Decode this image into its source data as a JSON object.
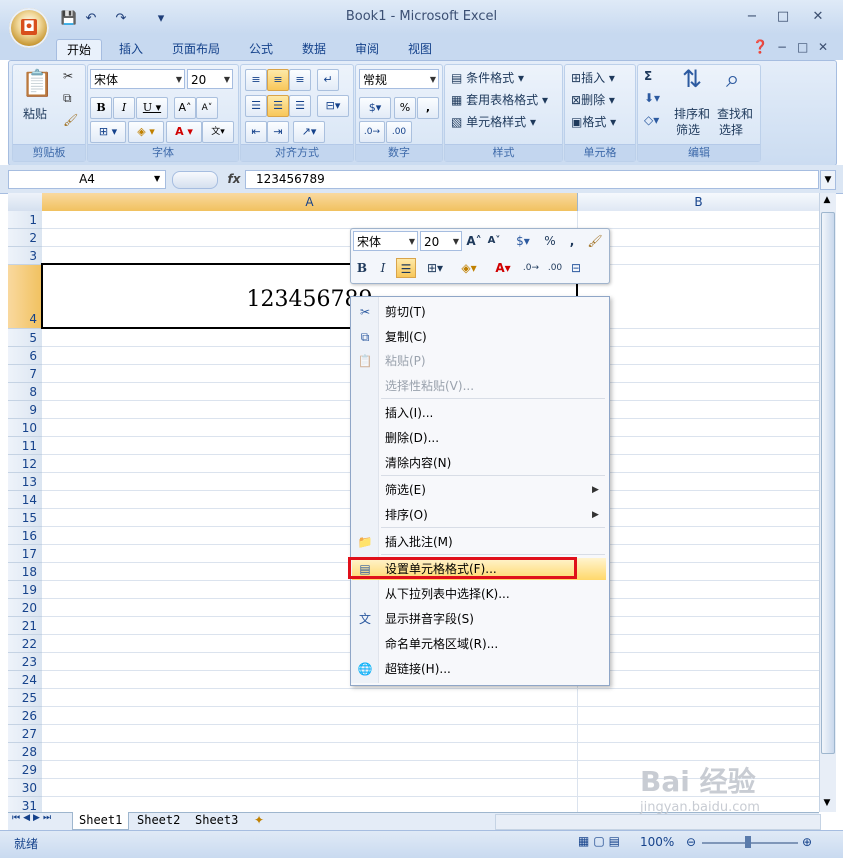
{
  "window": {
    "title": "Book1 - Microsoft Excel",
    "minimize": "−",
    "maximize": "□",
    "close": "✕"
  },
  "qat": {
    "save": "💾",
    "undo": "↶",
    "redo": "↷",
    "more": "▾"
  },
  "tabs": [
    "开始",
    "插入",
    "页面布局",
    "公式",
    "数据",
    "审阅",
    "视图"
  ],
  "ribbon": {
    "clipboard": {
      "label": "剪贴板",
      "paste": "粘贴"
    },
    "font": {
      "label": "字体",
      "name": "宋体",
      "size": "20"
    },
    "alignment": {
      "label": "对齐方式"
    },
    "number": {
      "label": "数字",
      "format": "常规",
      "percent": "%",
      "comma": ","
    },
    "styles": {
      "label": "样式",
      "conditional": "条件格式",
      "table": "套用表格格式",
      "cell": "单元格样式"
    },
    "cells": {
      "label": "单元格",
      "insert": "插入",
      "delete": "删除",
      "format": "格式"
    },
    "editing": {
      "label": "编辑",
      "sum": "Σ",
      "sort": "排序和\n筛选",
      "sort1": "排序和",
      "sort2": "筛选",
      "find1": "查找和",
      "find2": "选择"
    }
  },
  "formula_bar": {
    "name_box": "A4",
    "fx": "fx",
    "value": "123456789"
  },
  "columns": [
    "A",
    "B"
  ],
  "rows": [
    "1",
    "2",
    "3",
    "4",
    "5",
    "6",
    "7",
    "8",
    "9",
    "10",
    "11",
    "12",
    "13",
    "14",
    "15",
    "16",
    "17",
    "18",
    "19",
    "20",
    "21",
    "22",
    "23",
    "24",
    "25",
    "26",
    "27",
    "28",
    "29",
    "30",
    "31"
  ],
  "cell_a4": "123456789",
  "mini_toolbar": {
    "font": "宋体",
    "size": "20",
    "percent": "%",
    "comma": ","
  },
  "context_menu": [
    {
      "label": "剪切(T)",
      "icon": "scissors-icon",
      "disabled": false
    },
    {
      "label": "复制(C)",
      "icon": "copy-icon",
      "disabled": false
    },
    {
      "label": "粘贴(P)",
      "icon": "paste-icon",
      "disabled": true
    },
    {
      "label": "选择性粘贴(V)...",
      "icon": "",
      "disabled": true
    },
    {
      "label": "插入(I)...",
      "icon": "",
      "disabled": false
    },
    {
      "label": "删除(D)...",
      "icon": "",
      "disabled": false
    },
    {
      "label": "清除内容(N)",
      "icon": "",
      "disabled": false
    },
    {
      "label": "筛选(E)",
      "icon": "",
      "disabled": false,
      "submenu": true
    },
    {
      "label": "排序(O)",
      "icon": "",
      "disabled": false,
      "submenu": true
    },
    {
      "label": "插入批注(M)",
      "icon": "comment-icon",
      "disabled": false
    },
    {
      "label": "设置单元格格式(F)...",
      "icon": "format-cells-icon",
      "disabled": false,
      "highlighted": true
    },
    {
      "label": "从下拉列表中选择(K)...",
      "icon": "",
      "disabled": false
    },
    {
      "label": "显示拼音字段(S)",
      "icon": "phonetic-icon",
      "disabled": false
    },
    {
      "label": "命名单元格区域(R)...",
      "icon": "",
      "disabled": false
    },
    {
      "label": "超链接(H)...",
      "icon": "hyperlink-icon",
      "disabled": false
    }
  ],
  "sheets": [
    "Sheet1",
    "Sheet2",
    "Sheet3"
  ],
  "status": {
    "ready": "就绪",
    "zoom": "100%"
  },
  "watermark": {
    "line1": "Bai 经验",
    "line2": "jingyan.baidu.com"
  },
  "colors": {
    "highlight_border": "#e0101a",
    "accent": "#15428b"
  }
}
